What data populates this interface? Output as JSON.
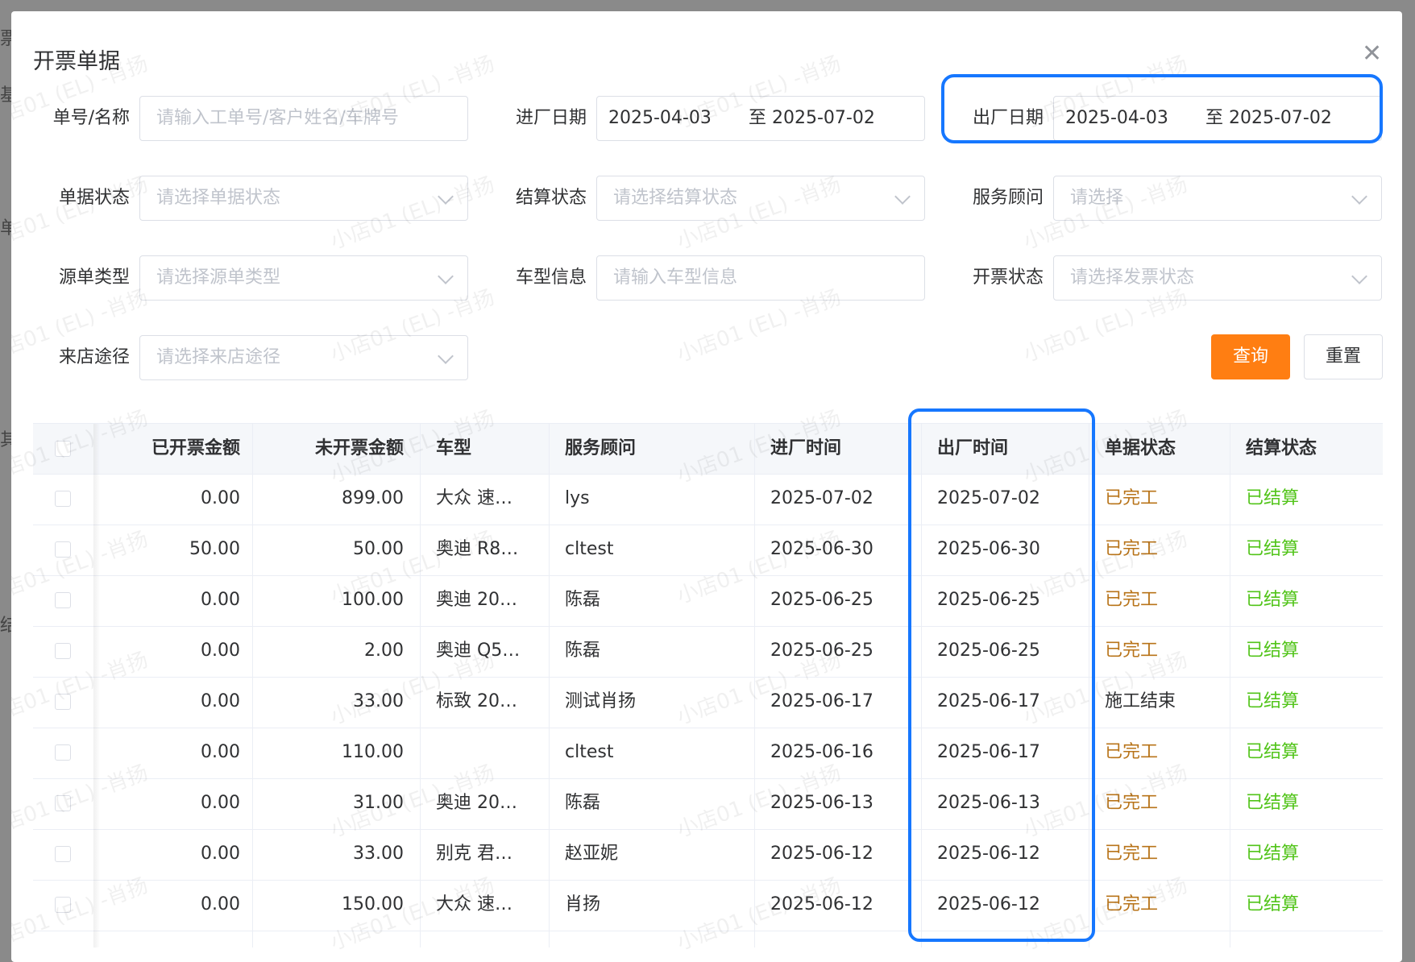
{
  "dialog": {
    "title": "开票单据"
  },
  "filters": {
    "order_no": {
      "label": "单号/名称",
      "placeholder": "请输入工单号/客户姓名/车牌号"
    },
    "in_date": {
      "label": "进厂日期",
      "start": "2025-04-03",
      "end": "至 2025-07-02"
    },
    "out_date": {
      "label": "出厂日期",
      "start": "2025-04-03",
      "end": "至 2025-07-02"
    },
    "doc_status": {
      "label": "单据状态",
      "placeholder": "请选择单据状态"
    },
    "settle_status": {
      "label": "结算状态",
      "placeholder": "请选择结算状态"
    },
    "advisor": {
      "label": "服务顾问",
      "placeholder": "请选择"
    },
    "source_type": {
      "label": "源单类型",
      "placeholder": "请选择源单类型"
    },
    "car_model": {
      "label": "车型信息",
      "placeholder": "请输入车型信息"
    },
    "invoice_status": {
      "label": "开票状态",
      "placeholder": "请选择发票状态"
    },
    "channel": {
      "label": "来店途径",
      "placeholder": "请选择来店途径"
    }
  },
  "buttons": {
    "query": "查询",
    "reset": "重置"
  },
  "table": {
    "headers": {
      "invoiced": "已开票金额",
      "uninvoiced": "未开票金额",
      "model": "车型",
      "advisor": "服务顾问",
      "in_time": "进厂时间",
      "out_time": "出厂时间",
      "doc_status": "单据状态",
      "settle_status": "结算状态"
    },
    "rows": [
      {
        "invoiced": "0.00",
        "uninvoiced": "899.00",
        "model": "大众 速…",
        "advisor": "lys",
        "in_time": "2025-07-02",
        "out_time": "2025-07-02",
        "doc_status": "已完工",
        "settle_status": "已结算"
      },
      {
        "invoiced": "50.00",
        "uninvoiced": "50.00",
        "model": "奥迪 R8…",
        "advisor": "cltest",
        "in_time": "2025-06-30",
        "out_time": "2025-06-30",
        "doc_status": "已完工",
        "settle_status": "已结算"
      },
      {
        "invoiced": "0.00",
        "uninvoiced": "100.00",
        "model": "奥迪 20…",
        "advisor": "陈磊",
        "in_time": "2025-06-25",
        "out_time": "2025-06-25",
        "doc_status": "已完工",
        "settle_status": "已结算"
      },
      {
        "invoiced": "0.00",
        "uninvoiced": "2.00",
        "model": "奥迪 Q5…",
        "advisor": "陈磊",
        "in_time": "2025-06-25",
        "out_time": "2025-06-25",
        "doc_status": "已完工",
        "settle_status": "已结算"
      },
      {
        "invoiced": "0.00",
        "uninvoiced": "33.00",
        "model": "标致 20…",
        "advisor": "测试肖扬",
        "in_time": "2025-06-17",
        "out_time": "2025-06-17",
        "doc_status": "施工结束",
        "settle_status": "已结算"
      },
      {
        "invoiced": "0.00",
        "uninvoiced": "110.00",
        "model": "",
        "advisor": "cltest",
        "in_time": "2025-06-16",
        "out_time": "2025-06-17",
        "doc_status": "已完工",
        "settle_status": "已结算"
      },
      {
        "invoiced": "0.00",
        "uninvoiced": "31.00",
        "model": "奥迪 20…",
        "advisor": "陈磊",
        "in_time": "2025-06-13",
        "out_time": "2025-06-13",
        "doc_status": "已完工",
        "settle_status": "已结算"
      },
      {
        "invoiced": "0.00",
        "uninvoiced": "33.00",
        "model": "别克 君…",
        "advisor": "赵亚妮",
        "in_time": "2025-06-12",
        "out_time": "2025-06-12",
        "doc_status": "已完工",
        "settle_status": "已结算"
      },
      {
        "invoiced": "0.00",
        "uninvoiced": "150.00",
        "model": "大众 速…",
        "advisor": "肖扬",
        "in_time": "2025-06-12",
        "out_time": "2025-06-12",
        "doc_status": "已完工",
        "settle_status": "已结算"
      }
    ]
  },
  "watermark": "小店01 (EL) -肖扬",
  "colors": {
    "primary": "#ff7e12",
    "highlight": "#1677ff",
    "done": "#b8741a",
    "settled": "#52c41a"
  }
}
